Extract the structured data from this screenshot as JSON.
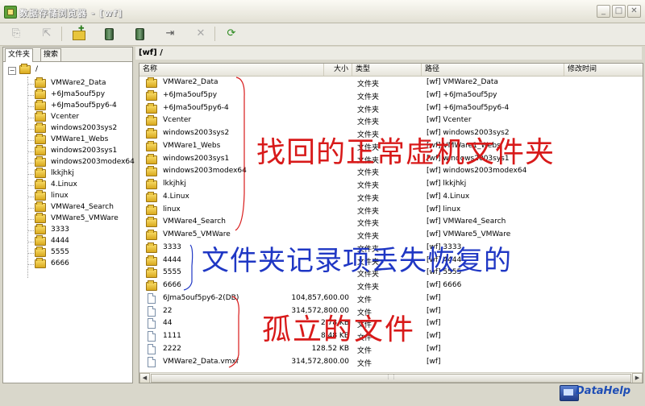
{
  "window": {
    "title": "数据存储浏览器 - [wf]",
    "min_label": "_",
    "max_label": "□",
    "close_label": "✕"
  },
  "toolbar": {
    "items": [
      {
        "icon": "copy-icon"
      },
      {
        "icon": "export-icon"
      },
      {
        "icon": "new-folder-icon"
      },
      {
        "icon": "disk-upload-icon"
      },
      {
        "icon": "disk-download-icon"
      },
      {
        "icon": "move-icon"
      },
      {
        "icon": "delete-icon"
      },
      {
        "icon": "refresh-icon"
      }
    ]
  },
  "left": {
    "tabs": [
      "文件夹",
      "搜索"
    ],
    "root": "/",
    "root_expander": "−",
    "items": [
      "VMWare2_Data",
      "+6Jma5ouf5py",
      "+6Jma5ouf5py6-4",
      "Vcenter",
      "windows2003sys2",
      "VMWare1_Webs",
      "windows2003sys1",
      "windows2003modex64",
      "lkkjhkj",
      "4.Linux",
      "linux",
      "VMWare4_Search",
      "VMWare5_VMWare",
      "3333",
      "4444",
      "5555",
      "6666"
    ]
  },
  "right": {
    "path": "[wf] /",
    "columns": {
      "name": "名称",
      "size": "大小",
      "type": "类型",
      "path": "路径",
      "modified": "修改时间"
    },
    "rows": [
      {
        "name": "VMWare2_Data",
        "size": "",
        "type": "文件夹",
        "path": "[wf] VMWare2_Data",
        "kind": "folder"
      },
      {
        "name": "+6Jma5ouf5py",
        "size": "",
        "type": "文件夹",
        "path": "[wf] +6Jma5ouf5py",
        "kind": "folder"
      },
      {
        "name": "+6Jma5ouf5py6-4",
        "size": "",
        "type": "文件夹",
        "path": "[wf] +6Jma5ouf5py6-4",
        "kind": "folder"
      },
      {
        "name": "Vcenter",
        "size": "",
        "type": "文件夹",
        "path": "[wf] Vcenter",
        "kind": "folder"
      },
      {
        "name": "windows2003sys2",
        "size": "",
        "type": "文件夹",
        "path": "[wf] windows2003sys2",
        "kind": "folder"
      },
      {
        "name": "VMWare1_Webs",
        "size": "",
        "type": "文件夹",
        "path": "[wf] VMWare1_Webs",
        "kind": "folder"
      },
      {
        "name": "windows2003sys1",
        "size": "",
        "type": "文件夹",
        "path": "[wf] windows2003sys1",
        "kind": "folder"
      },
      {
        "name": "windows2003modex64",
        "size": "",
        "type": "文件夹",
        "path": "[wf] windows2003modex64",
        "kind": "folder"
      },
      {
        "name": "lkkjhkj",
        "size": "",
        "type": "文件夹",
        "path": "[wf] lkkjhkj",
        "kind": "folder"
      },
      {
        "name": "4.Linux",
        "size": "",
        "type": "文件夹",
        "path": "[wf] 4.Linux",
        "kind": "folder"
      },
      {
        "name": "linux",
        "size": "",
        "type": "文件夹",
        "path": "[wf] linux",
        "kind": "folder"
      },
      {
        "name": "VMWare4_Search",
        "size": "",
        "type": "文件夹",
        "path": "[wf] VMWare4_Search",
        "kind": "folder"
      },
      {
        "name": "VMWare5_VMWare",
        "size": "",
        "type": "文件夹",
        "path": "[wf] VMWare5_VMWare",
        "kind": "folder"
      },
      {
        "name": "3333",
        "size": "",
        "type": "文件夹",
        "path": "[wf] 3333",
        "kind": "folder"
      },
      {
        "name": "4444",
        "size": "",
        "type": "文件夹",
        "path": "[wf] 4444",
        "kind": "folder"
      },
      {
        "name": "5555",
        "size": "",
        "type": "文件夹",
        "path": "[wf] 5555",
        "kind": "folder"
      },
      {
        "name": "6666",
        "size": "",
        "type": "文件夹",
        "path": "[wf] 6666",
        "kind": "folder"
      },
      {
        "name": "6Jma5ouf5py6-2(DB)",
        "size": "104,857,600.00",
        "type": "文件",
        "path": "[wf]",
        "kind": "file"
      },
      {
        "name": "22",
        "size": "314,572,800.00",
        "type": "文件",
        "path": "[wf]",
        "kind": "file"
      },
      {
        "name": "44",
        "size": "2.78 KB",
        "type": "文件",
        "path": "[wf]",
        "kind": "file"
      },
      {
        "name": "1111",
        "size": "8.48 KB",
        "type": "文件",
        "path": "[wf]",
        "kind": "file"
      },
      {
        "name": "2222",
        "size": "128.52 KB",
        "type": "文件",
        "path": "[wf]",
        "kind": "file"
      },
      {
        "name": "VMWare2_Data.vmxf",
        "size": "314,572,800.00",
        "type": "文件",
        "path": "[wf]",
        "kind": "file"
      }
    ]
  },
  "annotations": {
    "recovered_folders": "找回的正常虚机文件夹",
    "lost_records": "文件夹记录项丢失恢复的",
    "orphan_files": "孤立的文件",
    "color_red": "#d81a1a",
    "color_blue": "#1f37c4"
  },
  "watermark": {
    "text": "DataHelp"
  }
}
